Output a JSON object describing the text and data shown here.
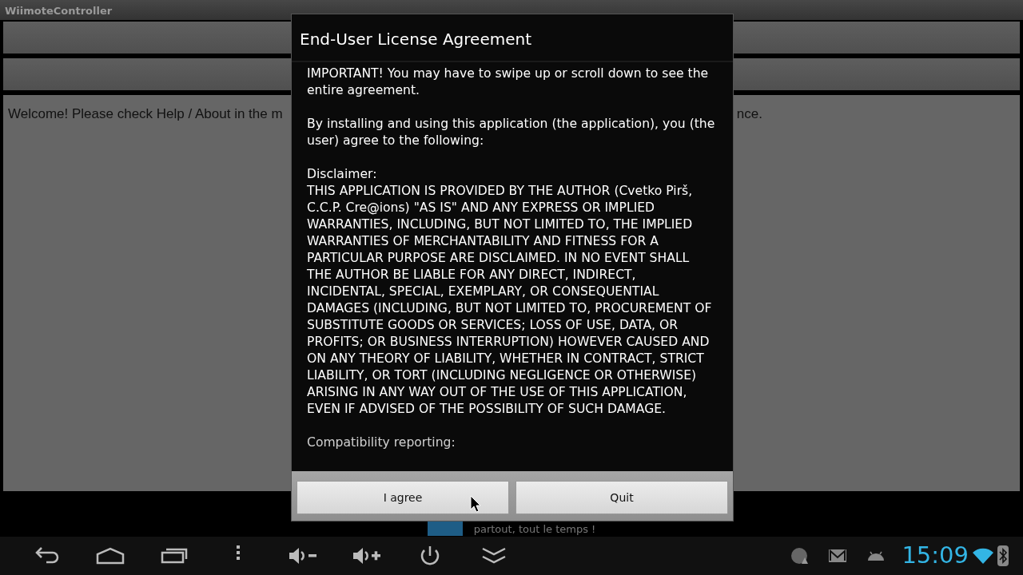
{
  "app": {
    "title": "WiimoteController",
    "message_start": "Welcome! Please check Help / About in the m",
    "message_end": "nce."
  },
  "ad": {
    "text": "partout, tout le temps !"
  },
  "dialog": {
    "title": "End-User License Agreement",
    "paragraphs": [
      {
        "kind": "paragraph",
        "text": "IMPORTANT! You may have to swipe up or scroll down to see the entire agreement."
      },
      {
        "kind": "paragraph",
        "text": "By installing and using this application (the application), you (the user) agree to the following:"
      },
      {
        "kind": "heading",
        "text": "Disclaimer:"
      },
      {
        "kind": "paragraph",
        "text": "THIS APPLICATION IS PROVIDED BY THE AUTHOR (Cvetko Pirš, C.C.P. Cre@ions) \"AS IS\" AND ANY EXPRESS OR IMPLIED WARRANTIES, INCLUDING, BUT NOT LIMITED TO, THE IMPLIED WARRANTIES OF MERCHANTABILITY AND FITNESS FOR A PARTICULAR PURPOSE ARE DISCLAIMED. IN NO EVENT SHALL THE AUTHOR BE LIABLE FOR ANY DIRECT, INDIRECT, INCIDENTAL, SPECIAL, EXEMPLARY, OR CONSEQUENTIAL DAMAGES (INCLUDING, BUT NOT LIMITED TO, PROCUREMENT OF SUBSTITUTE GOODS OR SERVICES; LOSS OF USE, DATA, OR PROFITS; OR BUSINESS INTERRUPTION) HOWEVER CAUSED AND ON ANY THEORY OF LIABILITY, WHETHER IN CONTRACT, STRICT LIABILITY, OR TORT (INCLUDING NEGLIGENCE OR OTHERWISE) ARISING IN ANY WAY OUT OF THE USE OF THIS APPLICATION, EVEN IF ADVISED OF THE POSSIBILITY OF SUCH DAMAGE."
      },
      {
        "kind": "heading",
        "text": "Compatibility reporting:"
      }
    ],
    "buttons": [
      {
        "label": "I agree"
      },
      {
        "label": "Quit"
      }
    ]
  },
  "navbar": {
    "buttons": [
      {
        "kind": "back"
      },
      {
        "kind": "home"
      },
      {
        "kind": "recents"
      },
      {
        "kind": "menu"
      },
      {
        "kind": "volume-down"
      },
      {
        "kind": "volume-up"
      },
      {
        "kind": "power"
      },
      {
        "kind": "collapse"
      }
    ]
  },
  "status": {
    "notifications": [
      {
        "kind": "disc-warning"
      },
      {
        "kind": "mail"
      },
      {
        "kind": "android"
      }
    ],
    "time": "15:09"
  }
}
